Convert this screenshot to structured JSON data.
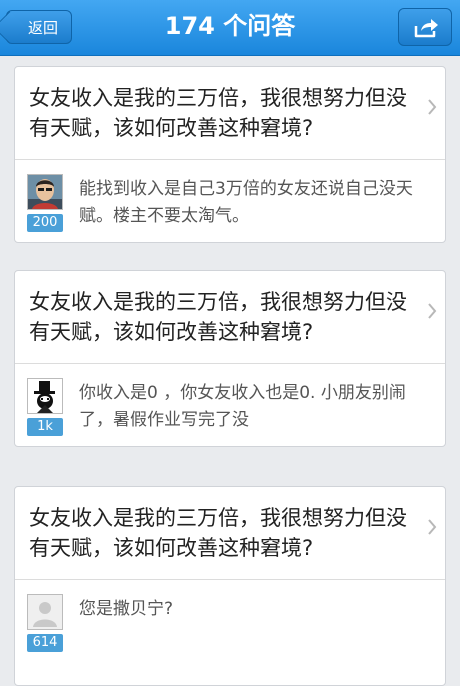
{
  "navbar": {
    "back_label": "返回",
    "title": "174 个问答",
    "share_icon": "share-icon"
  },
  "colors": {
    "nav_blue": "#1a86dc",
    "vote_badge": "#4aa0d8"
  },
  "items": [
    {
      "question": "女友收入是我的三万倍，我很想努力但没有天赋，该如何改善这种窘境?",
      "answer": "能找到收入是自己3万倍的女友还说自己没天赋。楼主不要太淘气。",
      "votes": "200",
      "avatar_icon": "user-photo-avatar"
    },
    {
      "question": "女友收入是我的三万倍，我很想努力但没有天赋，该如何改善这种窘境?",
      "answer": "你收入是0 ，你女友收入也是0. 小朋友别闹了，暑假作业写完了没",
      "votes": "1k",
      "avatar_icon": "top-hat-avatar"
    },
    {
      "question": "女友收入是我的三万倍，我很想努力但没有天赋，该如何改善这种窘境?",
      "answer": "您是撒贝宁?",
      "votes": "614",
      "avatar_icon": "default-avatar"
    }
  ]
}
